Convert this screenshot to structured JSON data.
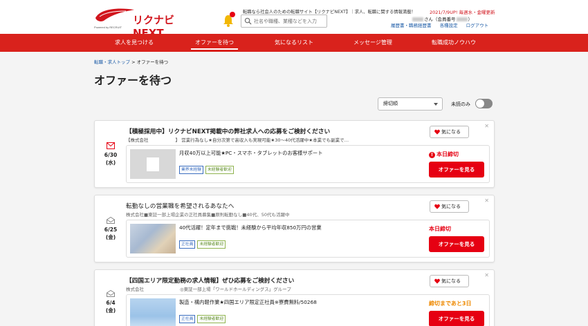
{
  "header": {
    "brand": "リクナビNEXT",
    "powered_by": "Powered by RECRUIT",
    "tagline": "転職なら社会人のための転職サイト【リクナビNEXT】｜求人、転職に関する情報満載！",
    "update": "2021/7/9UP! 毎週水・金曜更新",
    "user_suffix": "さん（会員番号",
    "user_close": "）",
    "search_placeholder": "社名や職種、業種などを入力",
    "links": [
      "履歴書・職務経歴書",
      "各種設定",
      "ログアウト"
    ]
  },
  "nav": {
    "items": [
      "求人を見つける",
      "オファーを待つ",
      "気になるリスト",
      "メッセージ管理",
      "転職成功ノウハウ"
    ]
  },
  "breadcrumb": {
    "home": "転職・求人トップ",
    "sep": " > ",
    "current": "オファーを待つ"
  },
  "page_title": "オファーを待つ",
  "sort": {
    "selected": "締切順",
    "unread_label": "未読のみ"
  },
  "cards": [
    {
      "date": "6/30",
      "dow": "(水)",
      "title": "【積極採用中】リクナビNEXT掲載中の弊社求人への応募をご検討ください",
      "sub": "【株式会社　　　　　　】 営業行為なし★自分次第で高収入も実現可能★30～40代活躍中★本業でも副業で…",
      "fav_label": "気になる",
      "job": "月収40万以上可能★PC・スマホ・タブレットのお客様サポート",
      "tags": [
        "業界未経験",
        "未経験者歓迎"
      ],
      "deadline": "本日締切",
      "button": "オファーを見る"
    },
    {
      "date": "6/25",
      "dow": "(金)",
      "title": "転勤なしの営業職を希望されるあなたへ",
      "sub": "株式会社■東証一部上場企業の正社員募集■原則転勤なし■40代、50代も活躍中",
      "fav_label": "気になる",
      "job": "40代活躍！定年まで挑戦！未経験から平均年収850万円の営業",
      "tags": [
        "正社員",
        "未経験者歓迎"
      ],
      "deadline": "本日締切",
      "button": "オファーを見る"
    },
    {
      "date": "6/4",
      "dow": "(金)",
      "title": "【四国エリア限定勤務の求人情報】ぜひ応募をご検討ください",
      "sub": "株式会社　　　　　　　　◎東証一部上場「ワールドホールディングス」グループ",
      "fav_label": "気になる",
      "job": "製造・構内軽作業★四国エリア限定正社員※寮費無料/50268",
      "tags": [
        "正社員",
        "未経験者歓迎"
      ],
      "deadline": "締切まであと3日",
      "button": "オファーを見る"
    }
  ],
  "colors": {
    "brand_red": "#d9221c",
    "button_red": "#e60012",
    "deadline_orange": "#ee8800",
    "link_blue": "#1a5aa6"
  }
}
